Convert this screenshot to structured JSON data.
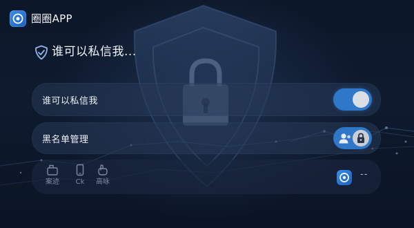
{
  "app": {
    "title": "圈圈APP",
    "logo_icon": "app-logo-icon"
  },
  "page": {
    "heading": "谁可以私信我...",
    "heading_icon": "shield-check-icon"
  },
  "settings": [
    {
      "label": "谁可以私信我",
      "control": "toggle",
      "enabled": true
    },
    {
      "label": "黑名单管理",
      "control": "blacklist-button",
      "icons": [
        "user-icon",
        "lock-icon"
      ]
    }
  ],
  "bottom_bar": {
    "items": [
      {
        "label": "案迹",
        "icon": "box-icon"
      },
      {
        "label": "Ck",
        "icon": "phone-icon"
      },
      {
        "label": "高咏",
        "icon": "hand-icon"
      }
    ],
    "right_logo_icon": "app-logo-icon",
    "right_text": "--"
  },
  "colors": {
    "background": "#0b1526",
    "accent": "#2f77c8",
    "row_bg": "#283a58"
  }
}
